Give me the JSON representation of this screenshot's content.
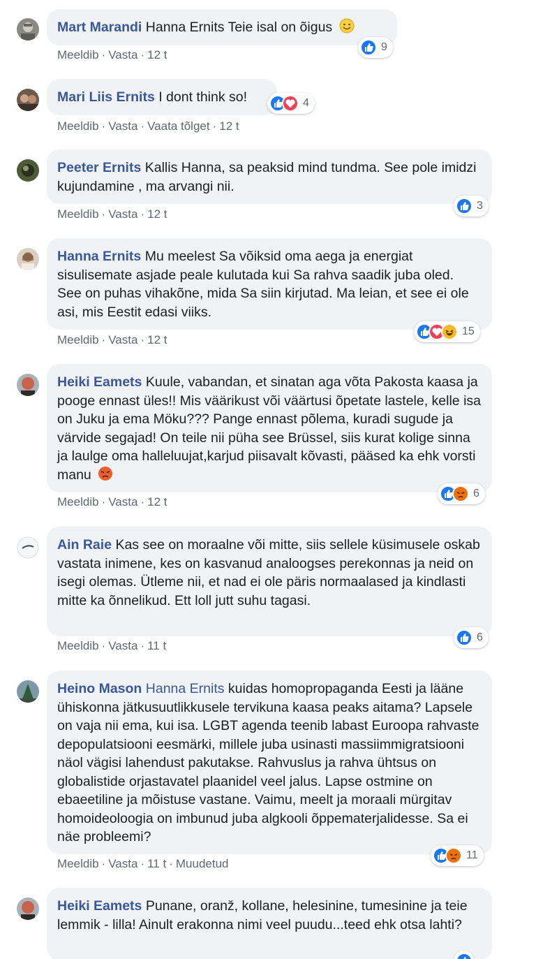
{
  "comments": [
    {
      "author": "Mart Marandi",
      "mention": "",
      "text": "Hanna Ernits Teie isal on õigus",
      "actions": {
        "like": "Meeldib",
        "reply": "Vasta",
        "translate": "",
        "time": "12 t",
        "edited": ""
      },
      "reactions": {
        "types": [
          "like"
        ],
        "count": "9"
      }
    },
    {
      "author": "Mari Liis Ernits",
      "mention": "",
      "text": "I dont think so!",
      "actions": {
        "like": "Meeldib",
        "reply": "Vasta",
        "translate": "Vaata tõlget",
        "time": "12 t",
        "edited": ""
      },
      "reactions": {
        "types": [
          "like",
          "love"
        ],
        "count": "4"
      }
    },
    {
      "author": "Peeter Ernits",
      "mention": "",
      "text": "Kallis Hanna, sa peaksid mind tundma. See pole imidzi kujundamine , ma arvangi nii.",
      "actions": {
        "like": "Meeldib",
        "reply": "Vasta",
        "translate": "",
        "time": "12 t",
        "edited": ""
      },
      "reactions": {
        "types": [
          "like"
        ],
        "count": "3"
      }
    },
    {
      "author": "Hanna Ernits",
      "mention": "",
      "text": "Mu meelest Sa võiksid oma aega ja energiat sisulisemate asjade peale kulutada kui Sa rahva saadik juba oled. See on puhas vihakõne, mida Sa siin kirjutad. Ma leian, et see ei ole asi, mis Eestit edasi viiks.",
      "actions": {
        "like": "Meeldib",
        "reply": "Vasta",
        "translate": "",
        "time": "12 t",
        "edited": ""
      },
      "reactions": {
        "types": [
          "like",
          "love",
          "haha"
        ],
        "count": "15"
      }
    },
    {
      "author": "Heiki Eamets",
      "mention": "",
      "text": "Kuule, vabandan, et sinatan aga võta Pakosta kaasa ja pooge ennast üles!! Mis väärikust või väärtusi õpetate lastele, kelle isa on Juku ja ema Möku??? Pange ennast põlema, kuradi sugude ja värvide segajad! On teile nii püha see Brüssel, siis kurat kolige sinna ja laulge oma halleluujat,karjud piisavalt kõvasti, pääsed ka ehk vorsti manu",
      "actions": {
        "like": "Meeldib",
        "reply": "Vasta",
        "translate": "",
        "time": "12 t",
        "edited": ""
      },
      "reactions": {
        "types": [
          "like",
          "angry"
        ],
        "count": "6"
      }
    },
    {
      "author": "Ain Raie",
      "mention": "",
      "text": "Kas see on moraalne või mitte, siis sellele küsimusele oskab vastata inimene, kes on kasvanud analoogses perekonnas ja neid on isegi olemas. Ütleme nii, et nad ei ole päris normaalased ja kindlasti mitte ka õnnelikud. Ett loll jutt suhu tagasi.",
      "actions": {
        "like": "Meeldib",
        "reply": "Vasta",
        "translate": "",
        "time": "11 t",
        "edited": ""
      },
      "reactions": {
        "types": [
          "like"
        ],
        "count": "6"
      }
    },
    {
      "author": "Heino Mason",
      "mention": "Hanna Ernits",
      "text": "kuidas homopropaganda Eesti ja lääne ühiskonna jätkusuutlikkusele tervikuna kaasa peaks aitama? Lapsele on vaja nii ema, kui isa. LGBT agenda teenib labast Euroopa rahvaste depopulatsiooni eesmärki, millele juba usinasti massiimmigratsiooni näol vägisi lahendust pakutakse. Rahvuslus ja rahva ühtsus on globalistide orjastavatel plaanidel veel jalus. Lapse ostmine on ebaeetiline ja mõistuse vastane. Vaimu, meelt ja moraali mürgitav homoideoloogia on imbunud juba algkooli õppematerjalidesse. Sa ei näe probleemi?",
      "actions": {
        "like": "Meeldib",
        "reply": "Vasta",
        "translate": "",
        "time": "11 t",
        "edited": "Muudetud"
      },
      "reactions": {
        "types": [
          "like",
          "angry"
        ],
        "count": "11"
      }
    },
    {
      "author": "Heiki Eamets",
      "mention": "",
      "text": "Punane, oranž, kollane, helesinine, tumesinine ja teie lemmik - lilla! Ainult erakonna nimi veel puudu...teed ehk otsa lahti?",
      "actions": {
        "like": "",
        "reply": "",
        "translate": "",
        "time": "",
        "edited": ""
      },
      "reactions": {
        "types": [
          "like"
        ],
        "count": ""
      }
    }
  ],
  "colors": {
    "author": "#385898",
    "bubble": "#f0f2f5",
    "meta": "#606770",
    "like": "#1877f2",
    "love": "#f33e58",
    "haha": "#f7b928",
    "angry": "#e9710f"
  }
}
